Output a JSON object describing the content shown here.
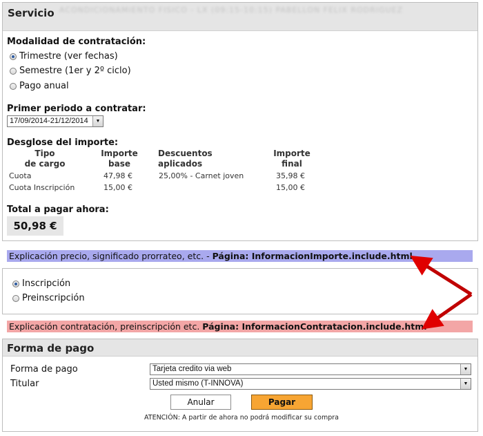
{
  "servicio": {
    "title": "Servicio",
    "blurred_text": "ACONDICIONAMIENTO FISICO - LX (09:15-10:15) PABELLON FELIX RODRIGUEZ"
  },
  "modalidad": {
    "label": "Modalidad de contratación:",
    "options": [
      "Trimestre (ver fechas)",
      "Semestre (1er y 2º ciclo)",
      "Pago anual"
    ],
    "selected_index": 0
  },
  "periodo": {
    "label": "Primer periodo a contratar:",
    "selected_value": "17/09/2014-21/12/2014"
  },
  "desglose": {
    "label": "Desglose del importe:",
    "headers": [
      {
        "line1": "Tipo",
        "line2": "de cargo"
      },
      {
        "line1": "Importe",
        "line2": "base"
      },
      {
        "line1": "Descuentos",
        "line2": "aplicados"
      },
      {
        "line1": "Importe",
        "line2": "final"
      }
    ],
    "rows": [
      {
        "tipo": "Cuota",
        "base": "47,98 €",
        "descuento": "25,00% - Carnet joven",
        "final": "35,98 €"
      },
      {
        "tipo": "Cuota Inscripción",
        "base": "15,00 €",
        "descuento": "",
        "final": "15,00 €"
      }
    ]
  },
  "total": {
    "label": "Total a pagar ahora:",
    "value": "50,98 €"
  },
  "band_precio": {
    "text": "Explicación precio, significado prorrateo, etc. - ",
    "page": "Página: InformacionImporte.include.html"
  },
  "inscripcion": {
    "options": [
      "Inscripción",
      "Preinscripción"
    ],
    "selected_index": 0
  },
  "band_contratacion": {
    "text": "Explicación contratación, preinscripción etc. ",
    "page": "Página: InformacionContratacion.include.html"
  },
  "pago": {
    "title": "Forma de pago",
    "forma_label": "Forma de pago",
    "forma_value": "Tarjeta credito via web",
    "titular_label": "Titular",
    "titular_value": "Usted mismo (T-INNOVA)",
    "anular_label": "Anular",
    "pagar_label": "Pagar",
    "note": "ATENCIÓN: A partir de ahora no podrá modificar su compra"
  },
  "colors": {
    "band_blue": "#a9a9ee",
    "band_pink": "#f3a6a6",
    "pagar_button": "#f7a533",
    "arrow": "#e00000"
  }
}
